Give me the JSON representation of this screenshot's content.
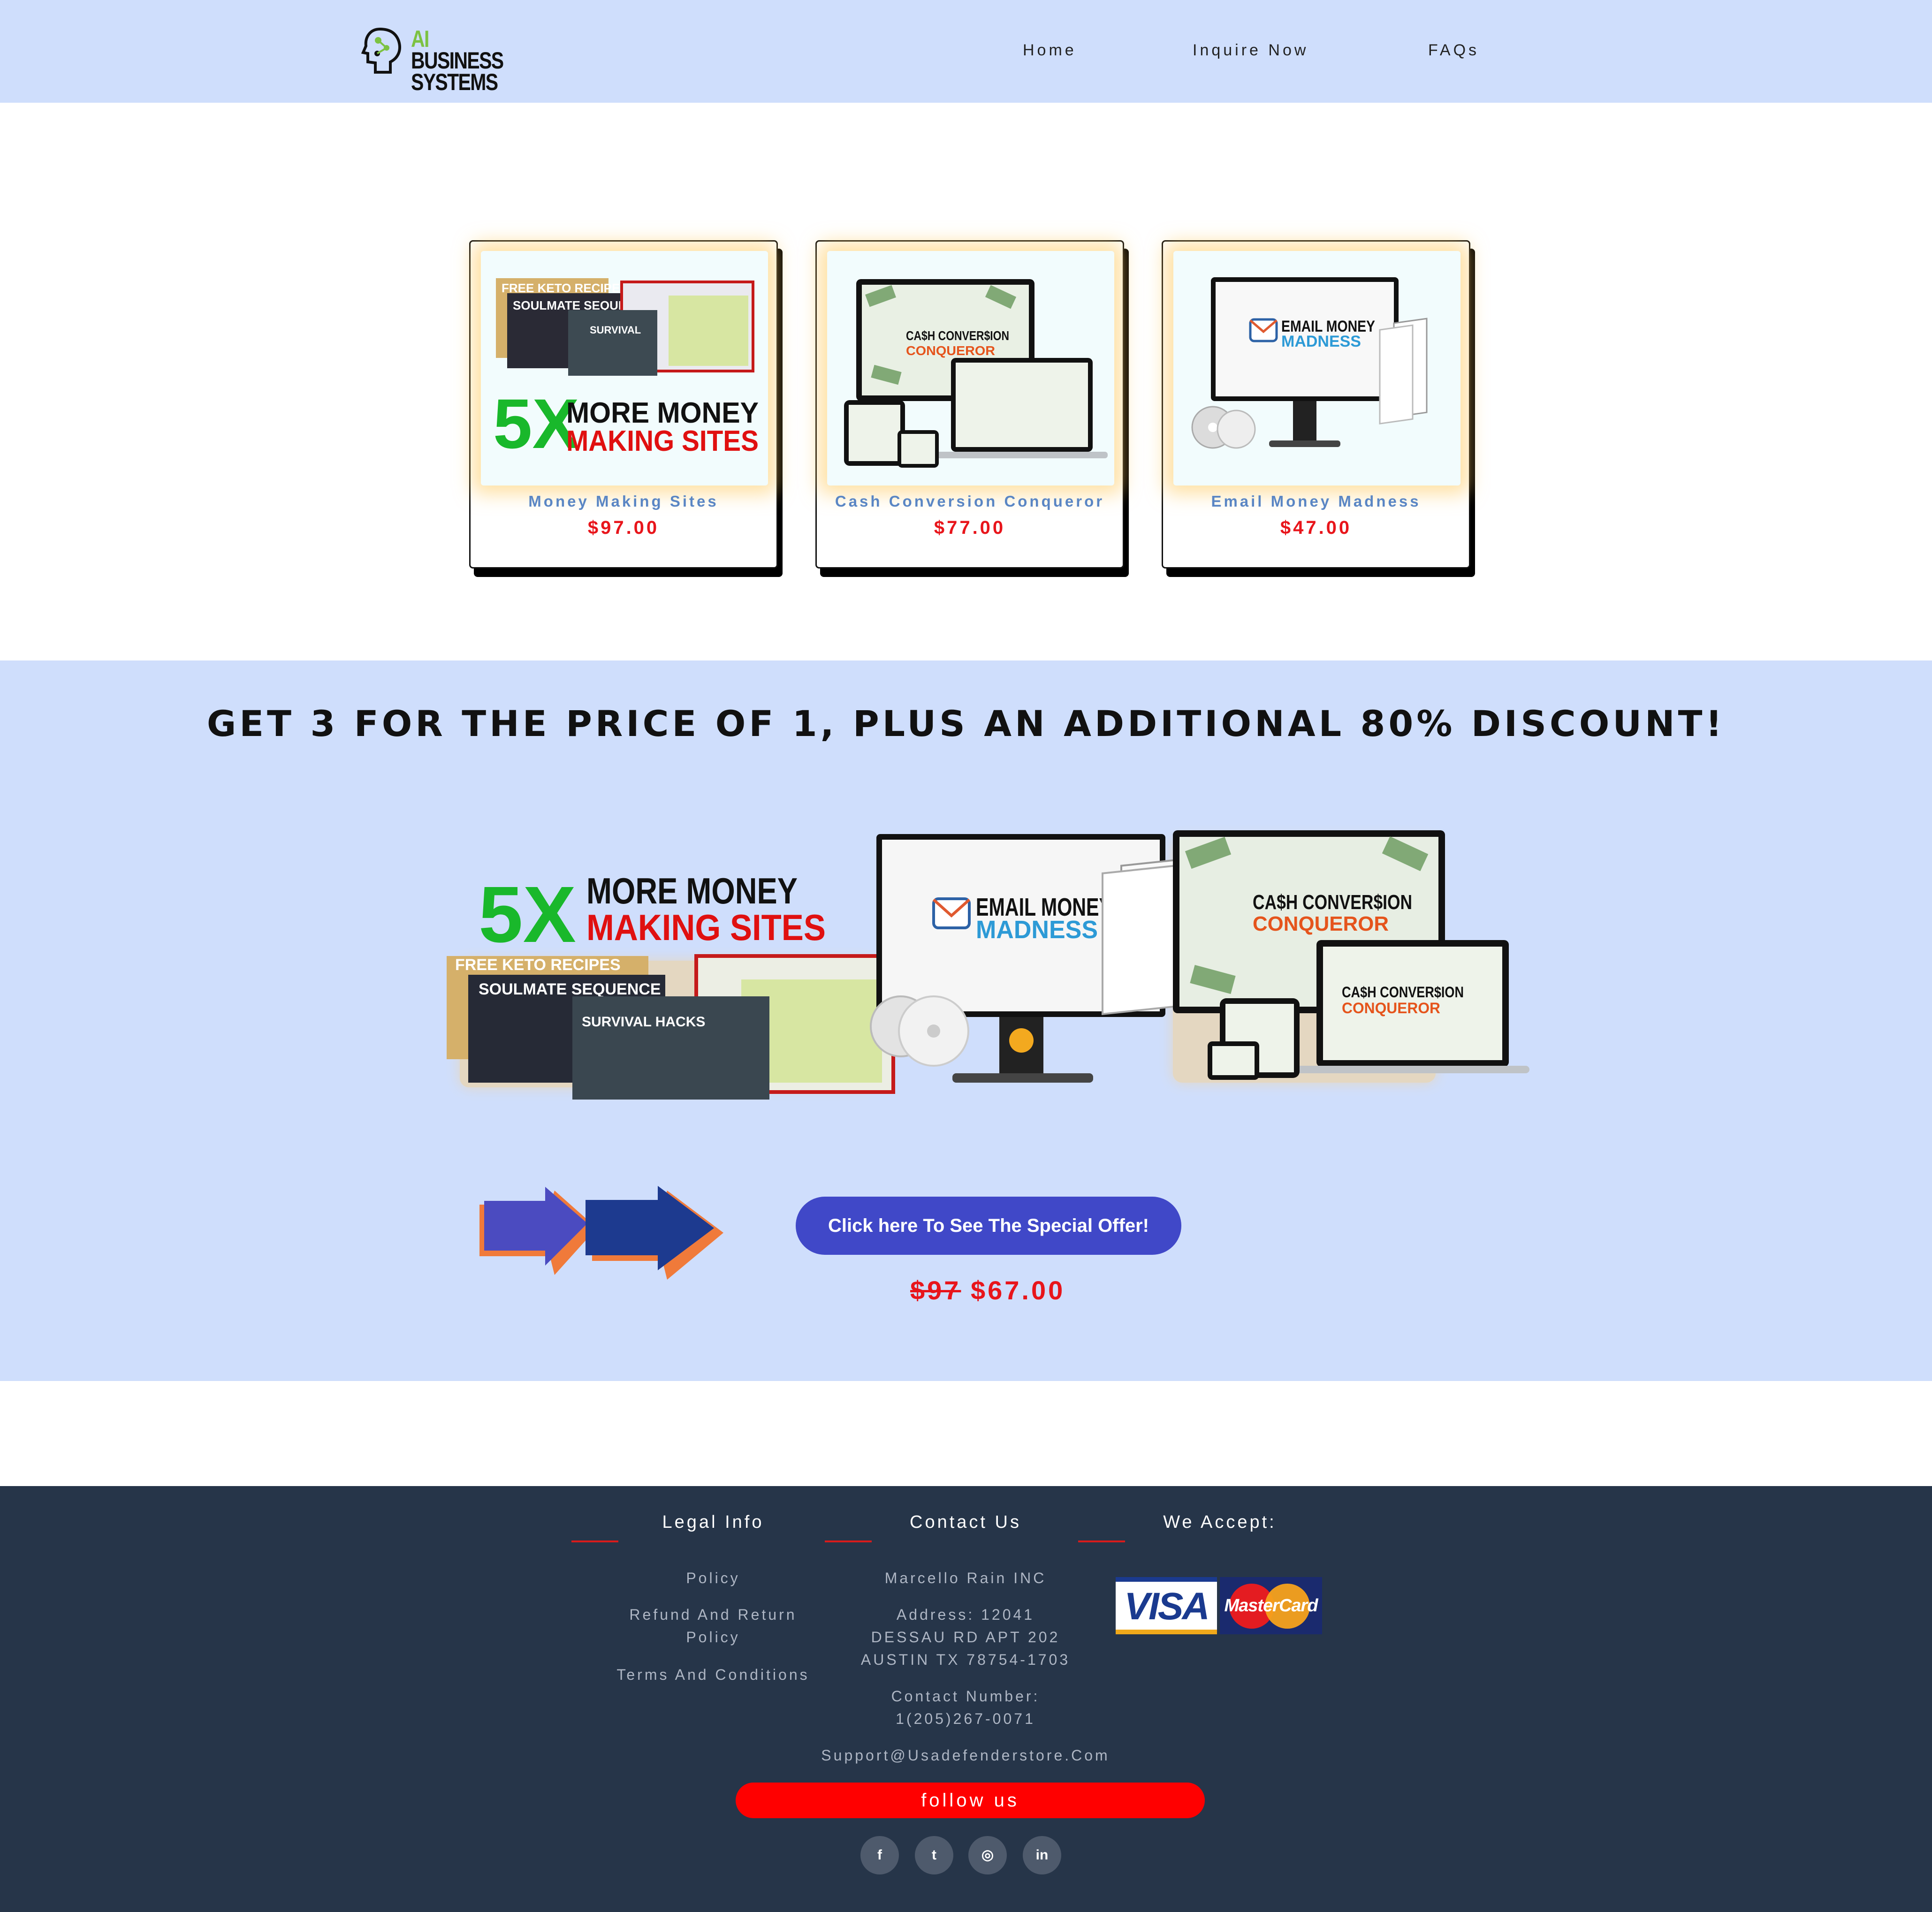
{
  "header": {
    "logo": {
      "line1_ai": "AI",
      "line1_rest": " BUSINESS",
      "line2": "SYSTEMS"
    },
    "nav": [
      {
        "label": "Home"
      },
      {
        "label": "Inquire Now"
      },
      {
        "label": "FAQs"
      }
    ]
  },
  "products": [
    {
      "title": "Money Making Sites",
      "price": "$97.00",
      "image_text": [
        "5X",
        "MORE MONEY",
        "MAKING SITES",
        "FREE KETO RECIPES",
        "SOULMATE SEQUENCE",
        "SURVIVAL"
      ]
    },
    {
      "title": "Cash Conversion Conqueror",
      "price": "$77.00",
      "image_text": [
        "CA$H CONVER$ION",
        "CONQUEROR"
      ]
    },
    {
      "title": "Email Money Madness",
      "price": "$47.00",
      "image_text": [
        "EMAIL MONEY",
        "MADNESS"
      ]
    }
  ],
  "offer": {
    "headline": "GET 3 FOR THE PRICE OF 1, PLUS AN ADDITIONAL 80% DISCOUNT!",
    "bundle_text": {
      "five_x": "5X",
      "more_money": "MORE MONEY",
      "making_sites": "MAKING SITES",
      "keto": "FREE KETO RECIPES",
      "soulmate": "SOULMATE SEQUENCE",
      "survival": "SURVIVAL HACKS",
      "email_line1": "EMAIL MONEY",
      "email_line2": "MADNESS",
      "cash_line1": "CA$H CONVER$ION",
      "cash_line2": "CONQUEROR"
    },
    "cta_label": "Click here To See The Special Offer!",
    "old_price": "$97",
    "new_price": "$67.00"
  },
  "footer": {
    "legal": {
      "heading": "Legal Info",
      "links": [
        "Policy",
        "Refund And Return",
        "Policy",
        "Terms And Conditions"
      ]
    },
    "contact": {
      "heading": "Contact Us",
      "company": "Marcello Rain INC",
      "address": [
        "Address: 12041",
        "DESSAU RD APT 202",
        "AUSTIN TX 78754-1703"
      ],
      "phone": [
        "Contact Number:",
        "1(205)267-0071"
      ],
      "email": "Support@Usadefenderstore.Com"
    },
    "accept": {
      "heading": "We Accept:",
      "visa": "VISA",
      "mastercard": "MasterCard"
    },
    "follow_label": "follow us",
    "social": [
      {
        "icon": "facebook-icon",
        "glyph": "f"
      },
      {
        "icon": "twitter-icon",
        "glyph": "t"
      },
      {
        "icon": "instagram-icon",
        "glyph": "◎"
      },
      {
        "icon": "linkedin-icon",
        "glyph": "in"
      }
    ]
  },
  "colors": {
    "header_bg": "#cfdefc",
    "footer_bg": "#263549",
    "accent_red": "#e8151b",
    "cta_blue": "#4048c8",
    "title_blue": "#5a86c4"
  }
}
